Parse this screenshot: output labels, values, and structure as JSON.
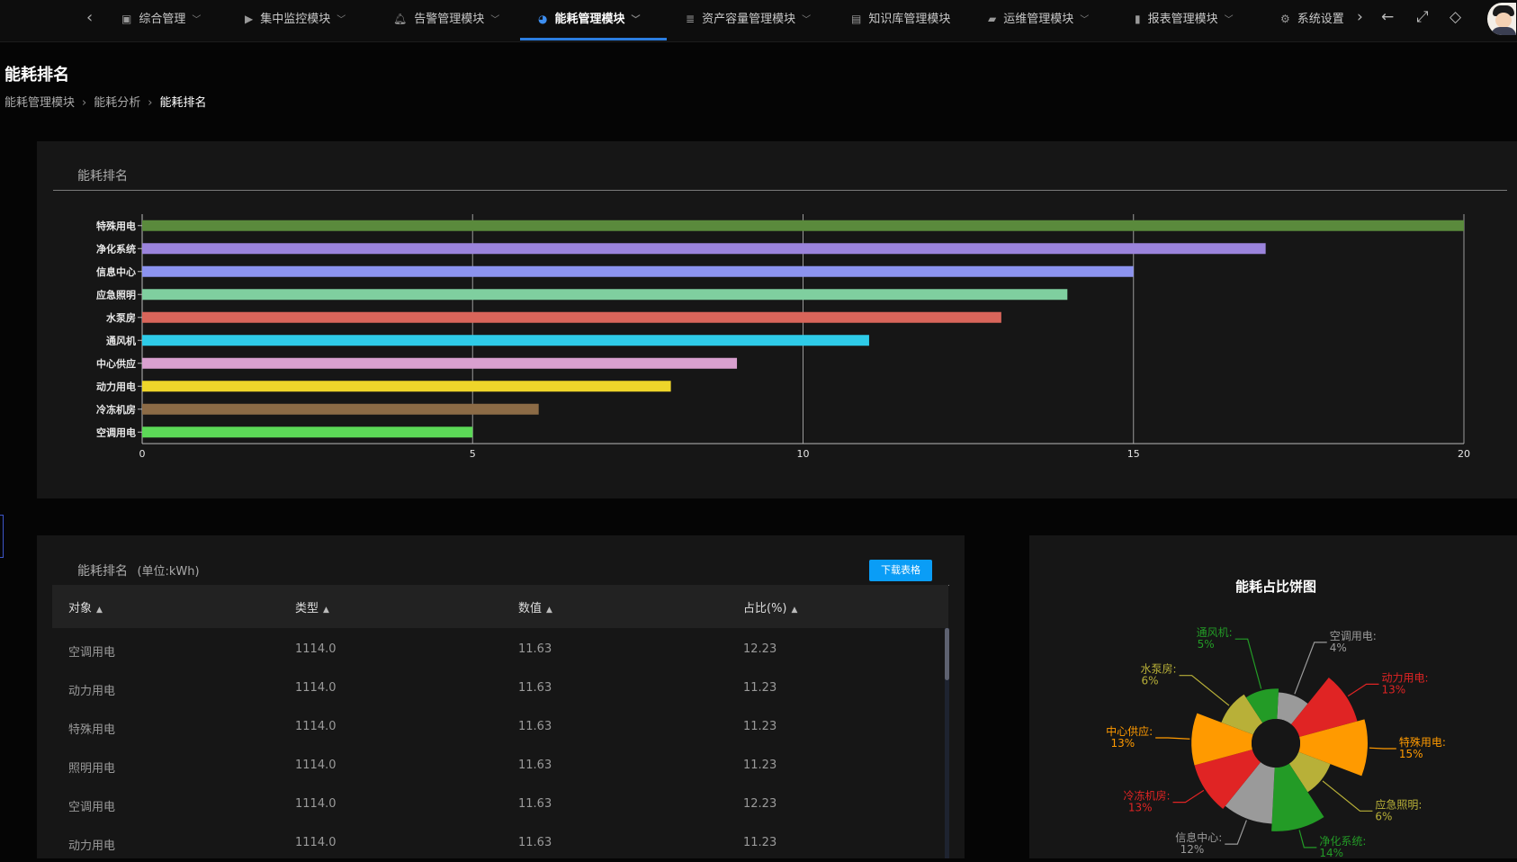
{
  "nav": {
    "items": [
      {
        "label": "综合管理",
        "icon": "dashboard-icon"
      },
      {
        "label": "集中监控模块",
        "icon": "monitor-icon"
      },
      {
        "label": "告警管理模块",
        "icon": "bell-icon"
      },
      {
        "label": "能耗管理模块",
        "icon": "pie-chart-icon"
      },
      {
        "label": "资产容量管理模块",
        "icon": "database-icon"
      },
      {
        "label": "知识库管理模块",
        "icon": "document-icon"
      },
      {
        "label": "运维管理模块",
        "icon": "briefcase-icon"
      },
      {
        "label": "报表管理模块",
        "icon": "report-icon"
      },
      {
        "label": "系统设置",
        "icon": "gear-icon"
      }
    ],
    "active": "能耗管理模块"
  },
  "page": {
    "title": "能耗排名",
    "breadcrumb": [
      "能耗管理模块",
      "能耗分析",
      "能耗排名"
    ]
  },
  "bar_panel": {
    "title": "能耗排名",
    "colors": [
      "#5a8a3c",
      "#9b84dc",
      "#8c93ef",
      "#7fcf9f",
      "#d8655a",
      "#2ecbe8",
      "#d9a0cf",
      "#eed52a",
      "#8c6b46",
      "#5cd957"
    ]
  },
  "chart_data": [
    {
      "type": "bar",
      "orientation": "horizontal",
      "categories": [
        "特殊用电",
        "净化系统",
        "信息中心",
        "应急照明",
        "水泵房",
        "通风机",
        "中心供应",
        "动力用电",
        "冷冻机房",
        "空调用电"
      ],
      "values": [
        20,
        17,
        15,
        14,
        13,
        11,
        9,
        8,
        6,
        5
      ],
      "xlim": [
        0,
        20
      ],
      "xticks": [
        0,
        5,
        10,
        15,
        20
      ],
      "grid": true
    },
    {
      "type": "pie",
      "title": "能耗占比饼图",
      "rose": true,
      "slices": [
        {
          "label": "空调用电",
          "value": 4,
          "pct": "4%",
          "color": "#9a9a9a"
        },
        {
          "label": "动力用电",
          "value": 13,
          "pct": "13%",
          "color": "#e02424"
        },
        {
          "label": "特殊用电",
          "value": 15,
          "pct": "15%",
          "color": "#ff9a00"
        },
        {
          "label": "应急照明",
          "value": 6,
          "pct": "6%",
          "color": "#b8b038"
        },
        {
          "label": "净化系统",
          "value": 14,
          "pct": "14%",
          "color": "#239b26"
        },
        {
          "label": "信息中心",
          "value": 12,
          "pct": "12%",
          "color": "#9a9a9a"
        },
        {
          "label": "冷冻机房",
          "value": 13,
          "pct": "13%",
          "color": "#e02424"
        },
        {
          "label": "中心供应",
          "value": 13,
          "pct": "13%",
          "color": "#ff9a00"
        },
        {
          "label": "水泵房",
          "value": 6,
          "pct": "6%",
          "color": "#b8b038"
        },
        {
          "label": "通风机",
          "value": 5,
          "pct": "5%",
          "color": "#239b26"
        }
      ]
    }
  ],
  "table": {
    "title": "能耗排名",
    "unit": "(单位:kWh)",
    "download_label": "下载表格",
    "columns": [
      "对象",
      "类型",
      "数值",
      "占比(%)"
    ],
    "rows": [
      [
        "空调用电",
        "1114.0",
        "11.63",
        "12.23"
      ],
      [
        "动力用电",
        "1114.0",
        "11.63",
        "11.23"
      ],
      [
        "特殊用电",
        "1114.0",
        "11.63",
        "11.23"
      ],
      [
        "照明用电",
        "1114.0",
        "11.63",
        "11.23"
      ],
      [
        "空调用电",
        "1114.0",
        "11.63",
        "12.23"
      ],
      [
        "动力用电",
        "1114.0",
        "11.63",
        "11.23"
      ]
    ]
  }
}
